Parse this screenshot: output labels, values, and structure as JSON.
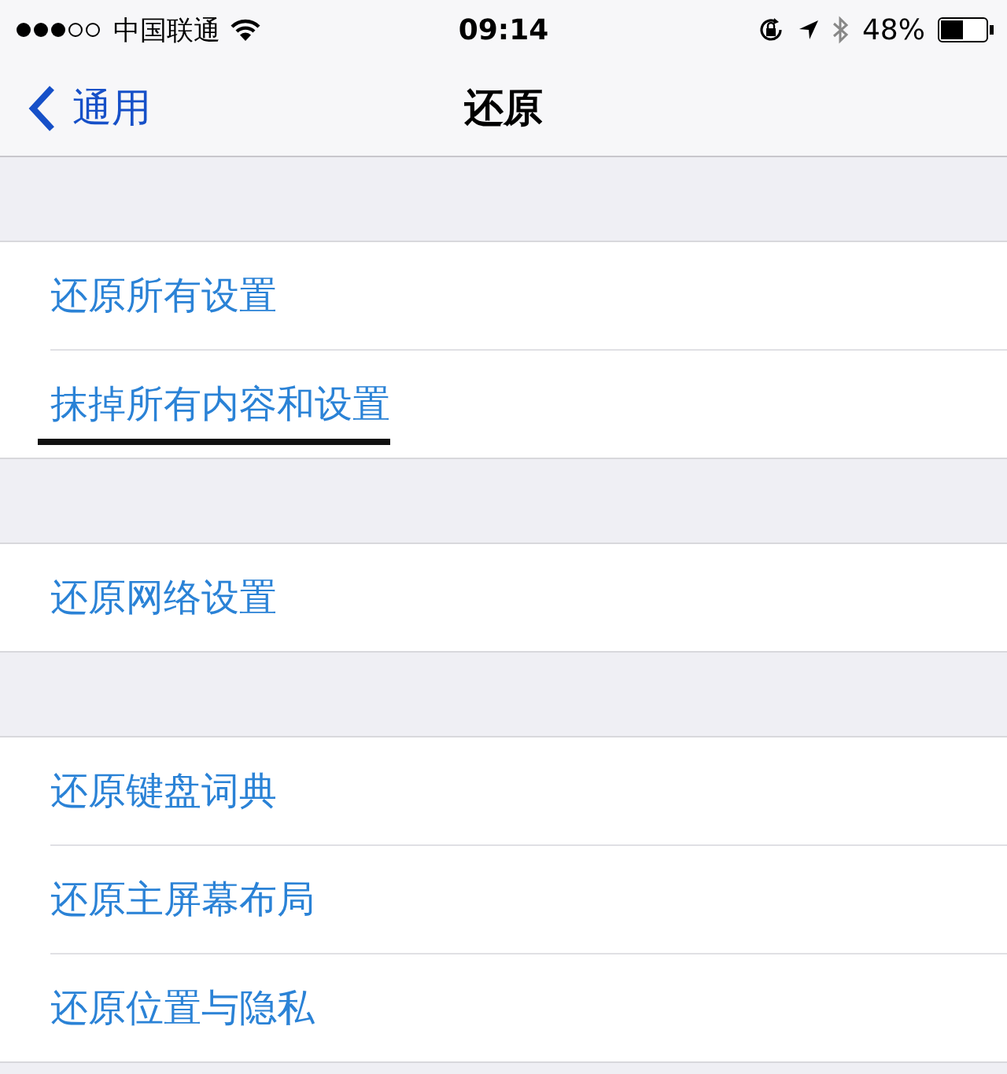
{
  "status_bar": {
    "carrier": "中国联通",
    "time": "09:14",
    "battery": "48%"
  },
  "nav_bar": {
    "back": "通用",
    "title": "还原"
  },
  "groups": [
    {
      "items": [
        {
          "label": "还原所有设置",
          "underlined": false
        },
        {
          "label": "抹掉所有内容和设置",
          "underlined": true
        }
      ]
    },
    {
      "items": [
        {
          "label": "还原网络设置",
          "underlined": false
        }
      ]
    },
    {
      "items": [
        {
          "label": "还原键盘词典",
          "underlined": false
        },
        {
          "label": "还原主屏幕布局",
          "underlined": false
        },
        {
          "label": "还原位置与隐私",
          "underlined": false
        }
      ]
    }
  ]
}
